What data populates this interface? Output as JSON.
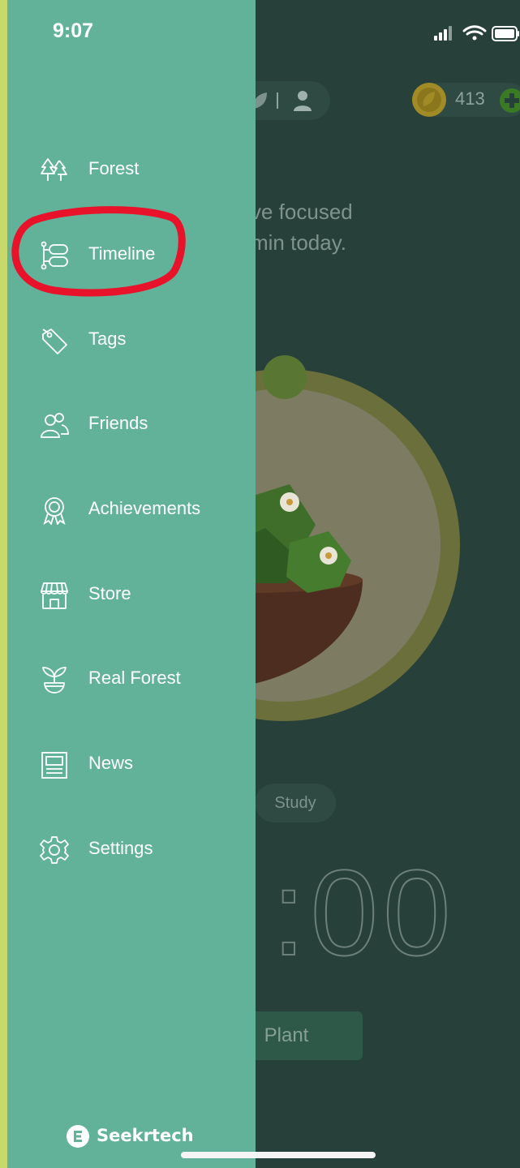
{
  "status_bar": {
    "time": "9:07"
  },
  "header": {
    "coins": "413"
  },
  "main": {
    "focus_text": [
      "ve focused",
      "min today."
    ],
    "tag_label": "Study",
    "timer_text": ":00",
    "plant_button_label": "Plant"
  },
  "drawer": {
    "items": [
      {
        "label": "Forest",
        "icon": "trees-icon"
      },
      {
        "label": "Timeline",
        "icon": "timeline-icon"
      },
      {
        "label": "Tags",
        "icon": "tag-icon"
      },
      {
        "label": "Friends",
        "icon": "friends-icon"
      },
      {
        "label": "Achievements",
        "icon": "medal-icon"
      },
      {
        "label": "Store",
        "icon": "store-icon"
      },
      {
        "label": "Real Forest",
        "icon": "sprout-icon"
      },
      {
        "label": "News",
        "icon": "news-icon"
      },
      {
        "label": "Settings",
        "icon": "gear-icon"
      }
    ],
    "highlighted_item": "Timeline"
  },
  "watermark": {
    "text": "Seekrtech"
  },
  "colors": {
    "drawer": "#62b29a",
    "background": "#27403a",
    "highlight": "#e8132a",
    "edge": "#c6d96a"
  }
}
